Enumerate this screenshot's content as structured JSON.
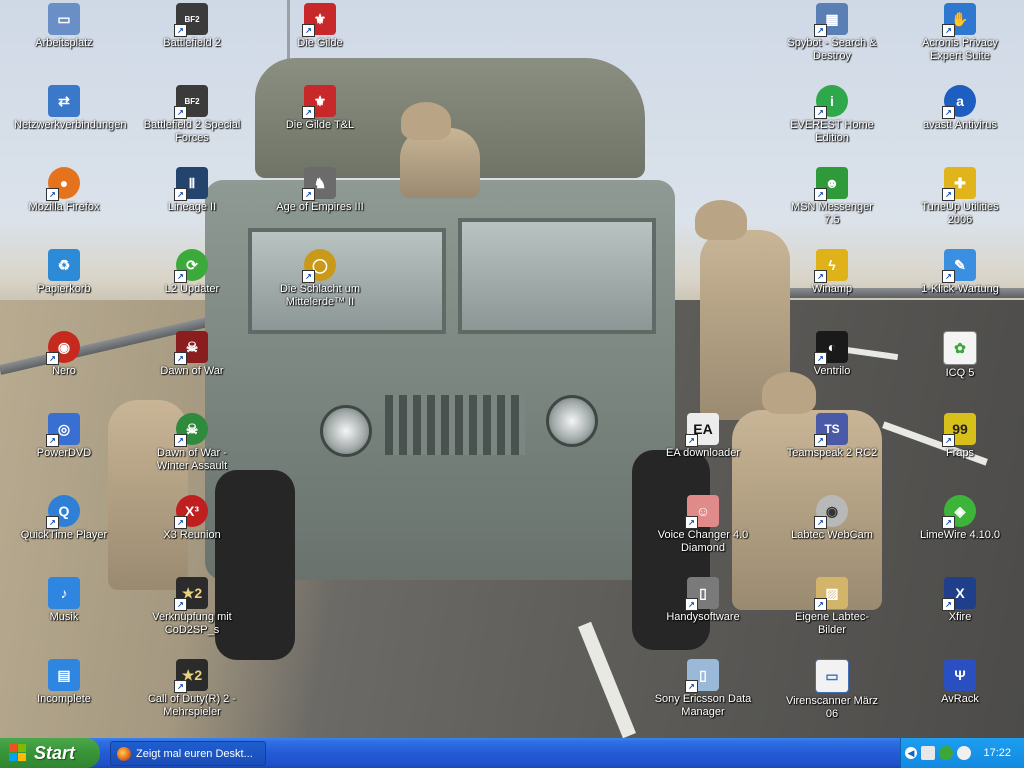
{
  "desktop": {
    "icons": [
      {
        "label": "Arbeitsplatz",
        "icon": "my-computer-icon",
        "color": "#6a8fc7"
      },
      {
        "label": "Netzwerkverbindungen",
        "icon": "network-connections-icon",
        "color": "#3a79c9"
      },
      {
        "label": "Mozilla Firefox",
        "icon": "firefox-icon",
        "color": "#e5731e"
      },
      {
        "label": "Papierkorb",
        "icon": "recycle-bin-icon",
        "color": "#2d8ad6"
      },
      {
        "label": "Nero",
        "icon": "nero-icon",
        "color": "#c62a1e"
      },
      {
        "label": "PowerDVD",
        "icon": "powerdvd-icon",
        "color": "#3a6fd2"
      },
      {
        "label": "QuickTime Player",
        "icon": "quicktime-icon",
        "color": "#2f7fd6"
      },
      {
        "label": "Musik",
        "icon": "music-folder-icon",
        "color": "#2f86e0"
      },
      {
        "label": "Incomplete",
        "icon": "incomplete-folder-icon",
        "color": "#2f86e0"
      },
      {
        "label": "Battlefield 2",
        "icon": "battlefield-2-icon",
        "color": "#3b3b3b"
      },
      {
        "label": "Battlefield 2 Special Forces",
        "icon": "battlefield-2-sf-icon",
        "color": "#3b3b3b"
      },
      {
        "label": "Lineage II",
        "icon": "lineage-2-icon",
        "color": "#24446e"
      },
      {
        "label": "L2 Updater",
        "icon": "l2-updater-icon",
        "color": "#3caa3a"
      },
      {
        "label": "Dawn of War",
        "icon": "dawn-of-war-icon",
        "color": "#8a1e1e"
      },
      {
        "label": "Dawn of War - Winter Assault",
        "icon": "dawn-of-war-winter-icon",
        "color": "#2e8a3c"
      },
      {
        "label": "X3 Reunion",
        "icon": "x3-reunion-icon",
        "color": "#c01f1f"
      },
      {
        "label": "Verknüpfung mit CoD2SP_s",
        "icon": "cod2-sp-icon",
        "color": "#2b2b2b"
      },
      {
        "label": "Call of Duty(R) 2 - Mehrspieler",
        "icon": "cod2-mp-icon",
        "color": "#2b2b2b"
      },
      {
        "label": "Die Gilde",
        "icon": "die-gilde-icon",
        "color": "#c8282a"
      },
      {
        "label": "Die Gilde T&L",
        "icon": "die-gilde-tl-icon",
        "color": "#c8282a"
      },
      {
        "label": "Age of Empires III",
        "icon": "age-of-empires-3-icon",
        "color": "#6b6b6b"
      },
      {
        "label": "Die Schlacht um Mittelerde™ II",
        "icon": "schlacht-mittelerde-icon",
        "color": "#c99a1a"
      },
      {
        "label": "EA downloader",
        "icon": "ea-downloader-icon",
        "color": "#ececec"
      },
      {
        "label": "Voice Changer 4.0 Diamond",
        "icon": "voice-changer-icon",
        "color": "#e08a8a"
      },
      {
        "label": "Handysoftware",
        "icon": "handysoftware-icon",
        "color": "#7a7a7a"
      },
      {
        "label": "Sony Ericsson Data Manager",
        "icon": "sony-ericsson-icon",
        "color": "#9ab8d8"
      },
      {
        "label": "Spybot - Search & Destroy",
        "icon": "spybot-icon",
        "color": "#5a7fb5"
      },
      {
        "label": "EVEREST Home Edition",
        "icon": "everest-icon",
        "color": "#2ea84a"
      },
      {
        "label": "MSN Messenger 7.5",
        "icon": "msn-messenger-icon",
        "color": "#2e9a3a"
      },
      {
        "label": "Winamp",
        "icon": "winamp-icon",
        "color": "#e0b21a"
      },
      {
        "label": "Ventrilo",
        "icon": "ventrilo-icon",
        "color": "#1a1a1a"
      },
      {
        "label": "Teamspeak 2 RC2",
        "icon": "teamspeak-icon",
        "color": "#4b5aa8"
      },
      {
        "label": "Labtec WebCam",
        "icon": "webcam-icon",
        "color": "#b8b8b8"
      },
      {
        "label": "Eigene Labtec-Bilder",
        "icon": "labtec-pictures-icon",
        "color": "#d2b46a"
      },
      {
        "label": "Virenscanner März 06",
        "icon": "virenscanner-icon",
        "color": "#3f6fb8"
      },
      {
        "label": "Acronis Privacy Expert Suite",
        "icon": "acronis-icon",
        "color": "#2f78d0"
      },
      {
        "label": "avast! Antivirus",
        "icon": "avast-icon",
        "color": "#1e5ec0"
      },
      {
        "label": "TuneUp Utilities 2006",
        "icon": "tuneup-icon",
        "color": "#e0b41a"
      },
      {
        "label": "1-Klick-Wartung",
        "icon": "one-click-maintenance-icon",
        "color": "#3a8fe0"
      },
      {
        "label": "ICQ 5",
        "icon": "icq-icon",
        "color": "#3ca83a"
      },
      {
        "label": "Fraps",
        "icon": "fraps-icon",
        "color": "#d8c01a"
      },
      {
        "label": "LimeWire 4.10.0",
        "icon": "limewire-icon",
        "color": "#3cb43a"
      },
      {
        "label": "Xfire",
        "icon": "xfire-icon",
        "color": "#1f3f8a"
      },
      {
        "label": "AvRack",
        "icon": "avrack-icon",
        "color": "#2a4fc0"
      }
    ]
  },
  "taskbar": {
    "start_label": "Start",
    "active_window": "Zeigt mal euren Deskt...",
    "clock": "17:22"
  }
}
